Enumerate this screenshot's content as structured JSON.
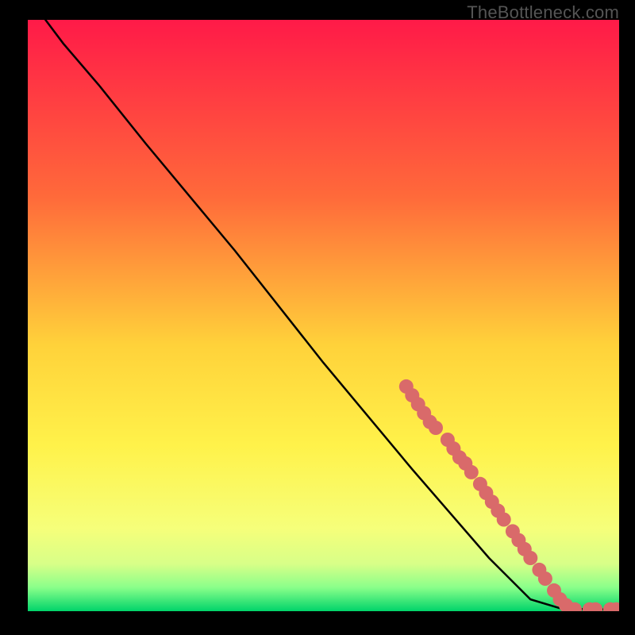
{
  "attribution": "TheBottleneck.com",
  "chart_data": {
    "type": "line",
    "title": "",
    "xlabel": "",
    "ylabel": "",
    "xlim": [
      0,
      100
    ],
    "ylim": [
      0,
      100
    ],
    "gradient": {
      "stops": [
        {
          "offset": 0,
          "color": "#ff1a48"
        },
        {
          "offset": 30,
          "color": "#ff6a3a"
        },
        {
          "offset": 55,
          "color": "#ffd23a"
        },
        {
          "offset": 72,
          "color": "#fff24a"
        },
        {
          "offset": 86,
          "color": "#f6ff7a"
        },
        {
          "offset": 92,
          "color": "#d8ff88"
        },
        {
          "offset": 96,
          "color": "#8aff8a"
        },
        {
          "offset": 100,
          "color": "#00d46a"
        }
      ]
    },
    "curve": [
      {
        "x": 3,
        "y": 100
      },
      {
        "x": 6,
        "y": 96
      },
      {
        "x": 12,
        "y": 89
      },
      {
        "x": 20,
        "y": 79
      },
      {
        "x": 35,
        "y": 61
      },
      {
        "x": 50,
        "y": 42
      },
      {
        "x": 65,
        "y": 24
      },
      {
        "x": 78,
        "y": 9
      },
      {
        "x": 85,
        "y": 2
      },
      {
        "x": 90,
        "y": 0.5
      },
      {
        "x": 95,
        "y": 0.3
      },
      {
        "x": 99,
        "y": 0.3
      }
    ],
    "highlight_points": [
      {
        "x": 64,
        "y": 38
      },
      {
        "x": 65,
        "y": 36.5
      },
      {
        "x": 66,
        "y": 35
      },
      {
        "x": 67,
        "y": 33.5
      },
      {
        "x": 68,
        "y": 32
      },
      {
        "x": 69,
        "y": 31
      },
      {
        "x": 71,
        "y": 29
      },
      {
        "x": 72,
        "y": 27.5
      },
      {
        "x": 73,
        "y": 26
      },
      {
        "x": 74,
        "y": 25
      },
      {
        "x": 75,
        "y": 23.5
      },
      {
        "x": 76.5,
        "y": 21.5
      },
      {
        "x": 77.5,
        "y": 20
      },
      {
        "x": 78.5,
        "y": 18.5
      },
      {
        "x": 79.5,
        "y": 17
      },
      {
        "x": 80.5,
        "y": 15.5
      },
      {
        "x": 82,
        "y": 13.5
      },
      {
        "x": 83,
        "y": 12
      },
      {
        "x": 84,
        "y": 10.5
      },
      {
        "x": 85,
        "y": 9
      },
      {
        "x": 86.5,
        "y": 7
      },
      {
        "x": 87.5,
        "y": 5.5
      },
      {
        "x": 89,
        "y": 3.5
      },
      {
        "x": 90,
        "y": 2
      },
      {
        "x": 91,
        "y": 1
      },
      {
        "x": 92.5,
        "y": 0.3
      },
      {
        "x": 95,
        "y": 0.3
      },
      {
        "x": 96,
        "y": 0.3
      },
      {
        "x": 98.5,
        "y": 0.3
      },
      {
        "x": 99.5,
        "y": 0.3
      }
    ],
    "point_color": "#d96a6a",
    "point_radius": 9
  }
}
